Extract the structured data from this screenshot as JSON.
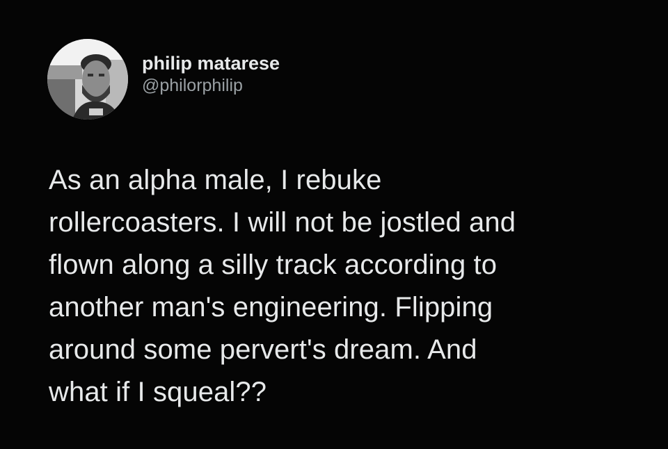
{
  "author": {
    "display_name": "philip matarese",
    "handle": "@philorphilip",
    "avatar_icon": "profile-photo"
  },
  "tweet": {
    "lines": [
      "As an alpha male, I rebuke",
      "rollercoasters. I will not be jostled and",
      "flown along a silly track according to",
      "another man's engineering. Flipping",
      "around some pervert's dream. And",
      "what if I squeal??"
    ]
  },
  "colors": {
    "background": "#050505",
    "text": "#e7e9ea",
    "secondary_text": "#9aa0a4"
  }
}
